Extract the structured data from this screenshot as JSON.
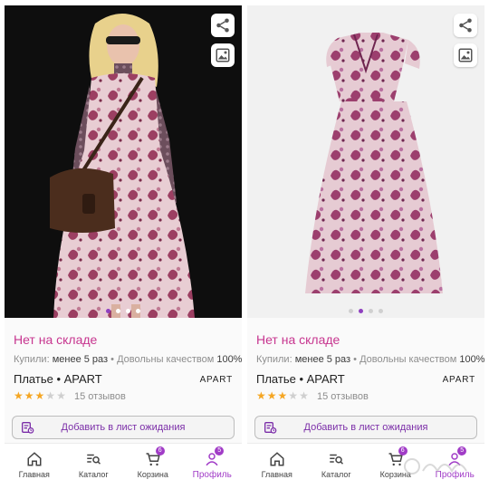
{
  "panels": [
    {
      "status": "Нет на складе",
      "bought_label": "Купили:",
      "bought_value": "менее 5 раз",
      "quality_label": "Довольны качеством",
      "quality_value": "100%",
      "title": "Платье • APART",
      "brand": "APART",
      "rating": 3,
      "reviews": "15 отзывов",
      "waitlist_label": "Добавить в лист ожидания",
      "carousel_active": 1,
      "carousel_count": 4,
      "photo": "model-wearing-paisley-dress"
    },
    {
      "status": "Нет на складе",
      "bought_label": "Купили:",
      "bought_value": "менее 5 раз",
      "quality_label": "Довольны качеством",
      "quality_value": "100%",
      "title": "Платье • APART",
      "brand": "APART",
      "rating": 3,
      "reviews": "15 отзывов",
      "waitlist_label": "Добавить в лист ожидания",
      "carousel_active": 2,
      "carousel_count": 4,
      "photo": "paisley-dress-product-shot"
    }
  ],
  "tabbar": {
    "home": "Главная",
    "catalog": "Каталог",
    "cart": "Корзина",
    "cart_badge": "6",
    "profile": "Профиль",
    "profile_badge": "5"
  },
  "icons": {
    "share": "share-icon",
    "photo_search": "photo-search-icon",
    "waitlist": "clipboard-icon",
    "home": "home-icon",
    "catalog": "catalog-search-icon",
    "cart": "cart-icon",
    "profile": "profile-icon"
  },
  "colors": {
    "accent": "#a13cc7",
    "status": "#c7358f",
    "star": "#f5a623"
  }
}
